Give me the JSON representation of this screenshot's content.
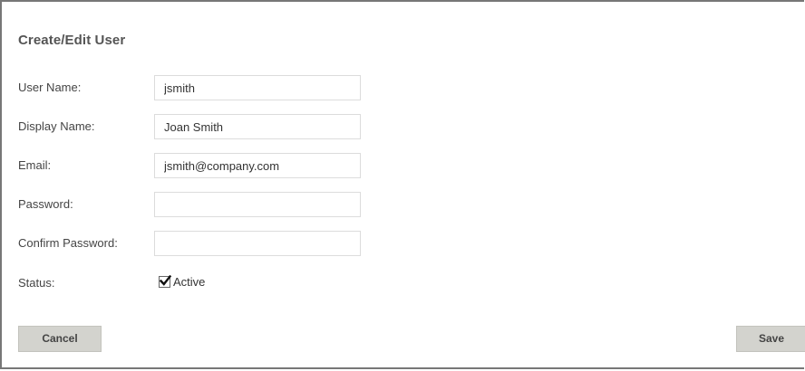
{
  "form": {
    "title": "Create/Edit User",
    "fields": {
      "username": {
        "label": "User Name:",
        "value": "jsmith",
        "placeholder": ""
      },
      "display_name": {
        "label": "Display Name:",
        "value": "Joan Smith",
        "placeholder": ""
      },
      "email": {
        "label": "Email:",
        "value": "jsmith@company.com",
        "placeholder": ""
      },
      "password": {
        "label": "Password:",
        "value": "",
        "placeholder": ""
      },
      "confirm_password": {
        "label": "Confirm Password:",
        "value": "",
        "placeholder": ""
      }
    },
    "status": {
      "label": "Status:",
      "checkbox_label": "Active",
      "checked": true
    },
    "buttons": {
      "cancel_label": "Cancel",
      "save_label": "Save"
    }
  },
  "colors": {
    "button_bg": "#d3d3ce",
    "field_border": "#dcdcdc",
    "frame_border": "#777777"
  },
  "icons": {
    "status_checkbox": "checkmark-icon"
  }
}
